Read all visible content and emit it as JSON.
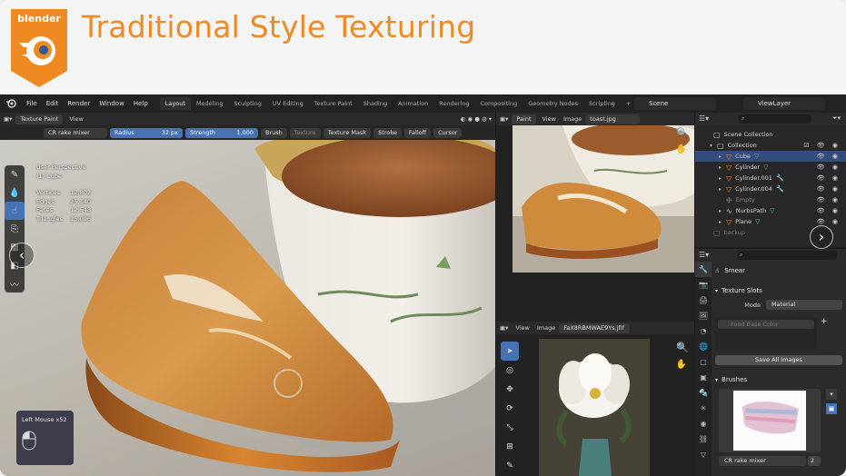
{
  "banner": {
    "logo_text": "blender",
    "title": "Traditional Style Texturing"
  },
  "menu": {
    "items": [
      "File",
      "Edit",
      "Render",
      "Window",
      "Help"
    ],
    "workspaces": [
      "Layout",
      "Modeling",
      "Sculpting",
      "UV Editing",
      "Texture Paint",
      "Shading",
      "Animation",
      "Rendering",
      "Compositing",
      "Geometry Nodes",
      "Scripting"
    ],
    "add_tab": "+",
    "scene": "Scene",
    "view_layer": "ViewLayer"
  },
  "viewport": {
    "mode": "Texture Paint",
    "view_menu": "View",
    "brush_name": "CR rake mixer",
    "radius_label": "Radius",
    "radius_value": "32 px",
    "strength_label": "Strength",
    "strength_value": "1.000",
    "tool_menus": [
      "Brush",
      "Texture",
      "Texture Mask",
      "Stroke",
      "Falloff",
      "Cursor"
    ],
    "perspective": "User Perspective",
    "object": "(1) Cube",
    "stats": [
      {
        "label": "Vertices",
        "value": "12,802"
      },
      {
        "label": "Edges",
        "value": "25,140"
      },
      {
        "label": "Faces",
        "value": "12,548"
      },
      {
        "label": "Triangles",
        "value": "25,096"
      }
    ],
    "mouse_hint": "Left Mouse x52"
  },
  "image_view_top": {
    "mode": "Paint",
    "menus": [
      "View",
      "Image"
    ],
    "image_name": "toast.jpg"
  },
  "image_view_bottom": {
    "menus": [
      "View",
      "Image"
    ],
    "image_name": "FaX8RBMWAE9Ys.jfif"
  },
  "outliner": {
    "rows": [
      {
        "name": "Scene Collection",
        "selected": false,
        "vis": ""
      },
      {
        "name": "Collection",
        "selected": false,
        "vis": "☑ 👁 ◉"
      },
      {
        "name": "Cube",
        "selected": true,
        "vis": "👁 ◉"
      },
      {
        "name": "Cylinder",
        "selected": false,
        "vis": "👁 ◉"
      },
      {
        "name": "Cylinder.001",
        "selected": false,
        "vis": "👁 ◉"
      },
      {
        "name": "Cylinder.004",
        "selected": false,
        "vis": "👁 ◉"
      },
      {
        "name": "Empty",
        "selected": false,
        "vis": "👁 ◉"
      },
      {
        "name": "NurbsPath",
        "selected": false,
        "vis": "👁 ◉"
      },
      {
        "name": "Plane",
        "selected": false,
        "vis": "👁 ◉"
      },
      {
        "name": "backup",
        "selected": false,
        "vis": ""
      }
    ]
  },
  "properties": {
    "brush_row": "Smear",
    "texture_slots_header": "Texture Slots",
    "mode_label": "Mode",
    "mode_value": "Material",
    "slot_item": "Food Base Color",
    "save_all": "Save All Images",
    "brushes_header": "Brushes",
    "brush_bottom": "CR rake mixer",
    "brush_users": "2"
  },
  "colors": {
    "accent": "#4772b3",
    "brand": "#ef8a23",
    "selection": "#334d80"
  }
}
